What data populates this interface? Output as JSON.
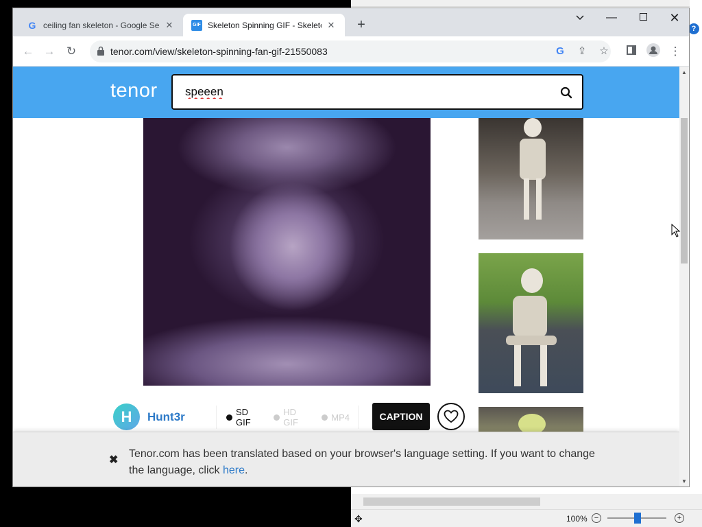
{
  "browser": {
    "tabs": [
      {
        "title": "ceiling fan skeleton - Google Sea",
        "favicon": "google-icon",
        "active": false
      },
      {
        "title": "Skeleton Spinning GIF - Skeleton",
        "favicon": "tenor-gif-icon",
        "favicon_text": "GIF",
        "active": true
      }
    ],
    "new_tab_label": "+",
    "url": "tenor.com/view/skeleton-spinning-fan-gif-21550083"
  },
  "page": {
    "logo": "tenor",
    "search": {
      "value": "speeen"
    },
    "author": {
      "initial": "H",
      "name": "Hunt3r"
    },
    "formats": [
      {
        "label": "SD GIF",
        "selected": true
      },
      {
        "label": "HD GIF",
        "selected": false
      },
      {
        "label": "MP4",
        "selected": false
      }
    ],
    "caption_label": "CAPTION",
    "notice": {
      "text": "Tenor.com has been translated based on your browser's language setting. If you want to change the language, click ",
      "link": "here",
      "suffix": "."
    }
  },
  "background_window": {
    "help_label": "?",
    "zoom": "100%",
    "zoom_minus": "−",
    "zoom_plus": "+"
  },
  "colors": {
    "tenor_blue": "#48a6f0",
    "link_blue": "#2d7ac8"
  }
}
